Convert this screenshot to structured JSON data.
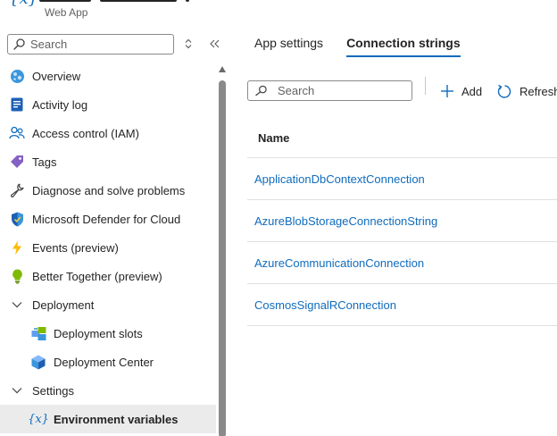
{
  "header": {
    "icon_glyph": "{x}",
    "subtitle": "Web App"
  },
  "sidebar": {
    "search_placeholder": "Search",
    "items": [
      {
        "label": "Overview",
        "icon": "globe-icon"
      },
      {
        "label": "Activity log",
        "icon": "activity-log-icon"
      },
      {
        "label": "Access control (IAM)",
        "icon": "people-icon"
      },
      {
        "label": "Tags",
        "icon": "tag-icon"
      },
      {
        "label": "Diagnose and solve problems",
        "icon": "wrench-icon"
      },
      {
        "label": "Microsoft Defender for Cloud",
        "icon": "shield-icon"
      },
      {
        "label": "Events (preview)",
        "icon": "lightning-icon"
      },
      {
        "label": "Better Together (preview)",
        "icon": "lightbulb-icon"
      },
      {
        "label": "Deployment",
        "icon": "chevron-down-icon",
        "group": true
      },
      {
        "label": "Deployment slots",
        "icon": "deployment-slots-icon"
      },
      {
        "label": "Deployment Center",
        "icon": "cube-icon"
      },
      {
        "label": "Settings",
        "icon": "chevron-down-icon",
        "group": true
      },
      {
        "label": "Environment variables",
        "icon": "variable-icon",
        "selected": true
      }
    ]
  },
  "main": {
    "tabs": [
      {
        "label": "App settings",
        "active": false
      },
      {
        "label": "Connection strings",
        "active": true
      }
    ],
    "search_placeholder": "Search",
    "toolbar": {
      "add_label": "Add",
      "refresh_label": "Refresh"
    },
    "table": {
      "column_name": "Name",
      "rows": [
        "ApplicationDbContextConnection",
        "AzureBlobStorageConnectionString",
        "AzureCommunicationConnection",
        "CosmosSignalRConnection"
      ]
    }
  },
  "colors": {
    "accent": "#0f6cbd",
    "selected_bg": "#ebebeb",
    "text": "#242424"
  }
}
